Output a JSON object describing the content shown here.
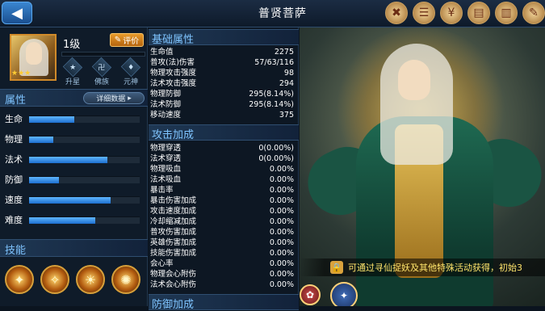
{
  "header": {
    "title": "普贤菩萨",
    "back_icon": "◀",
    "top_icons": [
      {
        "name": "cancel-seal-icon",
        "glyph": "✖"
      },
      {
        "name": "scroll-icon",
        "glyph": "☰"
      },
      {
        "name": "coin-icon",
        "glyph": "¥"
      },
      {
        "name": "document-icon",
        "glyph": "▤"
      },
      {
        "name": "book-icon",
        "glyph": "▥"
      },
      {
        "name": "quill-icon",
        "glyph": "✎"
      }
    ]
  },
  "hero": {
    "level": "1级",
    "eval_label": "评价",
    "stars": "★★★",
    "actions": [
      {
        "label": "升星",
        "glyph": "★"
      },
      {
        "label": "佛族",
        "glyph": "卍"
      },
      {
        "label": "元神",
        "glyph": "♦"
      }
    ]
  },
  "attributes": {
    "title": "属性",
    "detail_label": "详细数据",
    "stats": [
      {
        "label": "生命",
        "fill": 0.41
      },
      {
        "label": "物理",
        "fill": 0.22
      },
      {
        "label": "法术",
        "fill": 0.71
      },
      {
        "label": "防御",
        "fill": 0.27
      },
      {
        "label": "速度",
        "fill": 0.74
      },
      {
        "label": "难度",
        "fill": 0.6
      }
    ]
  },
  "skills": {
    "title": "技能",
    "glyphs": [
      "✦",
      "✧",
      "☀",
      "✺"
    ]
  },
  "basic": {
    "title": "基础属性",
    "rows": [
      {
        "k": "生命值",
        "v": "2275"
      },
      {
        "k": "普攻(法)伤害",
        "v": "57/63/116"
      },
      {
        "k": "物理攻击强度",
        "v": "98"
      },
      {
        "k": "法术攻击强度",
        "v": "294"
      },
      {
        "k": "物理防御",
        "v": "295(8.14%)"
      },
      {
        "k": "法术防御",
        "v": "295(8.14%)"
      },
      {
        "k": "移动速度",
        "v": "375"
      }
    ]
  },
  "attack": {
    "title": "攻击加成",
    "rows": [
      {
        "k": "物理穿透",
        "v": "0(0.00%)"
      },
      {
        "k": "法术穿透",
        "v": "0(0.00%)"
      },
      {
        "k": "物理吸血",
        "v": "0.00%"
      },
      {
        "k": "法术吸血",
        "v": "0.00%"
      },
      {
        "k": "暴击率",
        "v": "0.00%"
      },
      {
        "k": "暴击伤害加成",
        "v": "0.00%"
      },
      {
        "k": "攻击速度加成",
        "v": "0.00%"
      },
      {
        "k": "冷却缩减加成",
        "v": "0.00%"
      },
      {
        "k": "普攻伤害加成",
        "v": "0.00%"
      },
      {
        "k": "英雄伤害加成",
        "v": "0.00%"
      },
      {
        "k": "技能伤害加成",
        "v": "0.00%"
      },
      {
        "k": "会心率",
        "v": "0.00%"
      },
      {
        "k": "物理会心附伤",
        "v": "0.00%"
      },
      {
        "k": "法术会心附伤",
        "v": "0.00%"
      }
    ]
  },
  "defense": {
    "title": "防御加成"
  },
  "notice": {
    "text": "可通过寻仙捉妖及其他特殊活动获得，初始3"
  }
}
